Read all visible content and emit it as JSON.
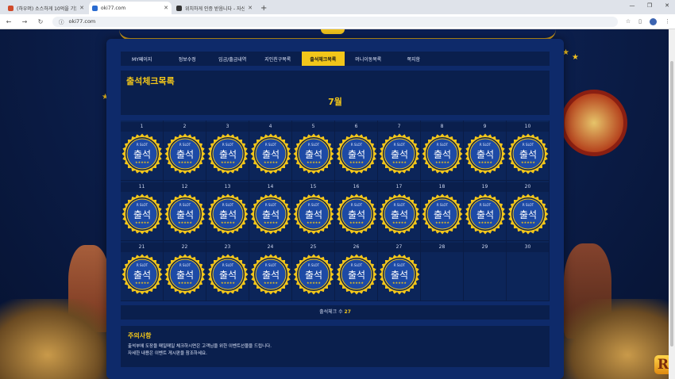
{
  "browser": {
    "tabs": [
      {
        "label": "(하우머) 소스하게 10억을 기일 다",
        "active": false
      },
      {
        "label": "oki77.com",
        "active": true
      },
      {
        "label": "위치하게 인증 받음니다 - 자신",
        "active": false
      }
    ],
    "url": "oki77.com"
  },
  "menu": [
    {
      "label": "MY페이지",
      "active": false
    },
    {
      "label": "정보수정",
      "active": false
    },
    {
      "label": "입금/출금내역",
      "active": false
    },
    {
      "label": "지인친구목록",
      "active": false
    },
    {
      "label": "출석체크목록",
      "active": true
    },
    {
      "label": "머니이동목록",
      "active": false
    },
    {
      "label": "쪽지함",
      "active": false
    }
  ],
  "attendance": {
    "title": "출석체크목록",
    "month": "7월",
    "days": [
      "1",
      "2",
      "3",
      "4",
      "5",
      "6",
      "7",
      "8",
      "9",
      "10",
      "11",
      "12",
      "13",
      "14",
      "15",
      "16",
      "17",
      "18",
      "19",
      "20",
      "21",
      "22",
      "23",
      "24",
      "25",
      "26",
      "27",
      "28",
      "29",
      "30"
    ],
    "checked_count": 27,
    "stamp": {
      "top": "R SLOT",
      "main": "출석",
      "stars": "★★★★★"
    },
    "count_label": "출석체크 수",
    "count_value": "27"
  },
  "notice": {
    "title": "주의사항",
    "lines": [
      "출석부에 도장을 매일매일 체크하시면은 고객님을 위한 이벤트선물을 드립니다.",
      "자세한 내용은 이벤트 게시판을 참조하세요."
    ]
  },
  "colors": {
    "accent": "#f2c61a",
    "panel": "#0e2a6a",
    "stamp_fill": "#1d4aa5"
  }
}
